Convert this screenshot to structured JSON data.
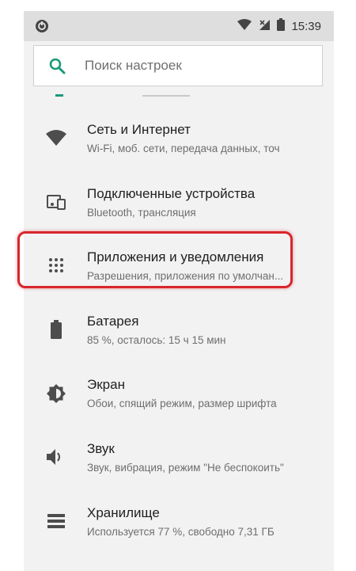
{
  "status_bar": {
    "time": "15:39",
    "icons": [
      "sync-icon",
      "wifi-icon",
      "no-signal-icon",
      "battery-icon"
    ]
  },
  "search": {
    "placeholder": "Поиск настроек"
  },
  "settings_items": [
    {
      "title": "Сеть и Интернет",
      "subtitle": "Wi-Fi, моб. сети, передача данных, точ",
      "icon": "wifi-icon"
    },
    {
      "title": "Подключенные устройства",
      "subtitle": "Bluetooth, трансляция",
      "icon": "devices-icon"
    },
    {
      "title": "Приложения и уведомления",
      "subtitle": "Разрешения, приложения по умолчан...",
      "icon": "apps-grid-icon"
    },
    {
      "title": "Батарея",
      "subtitle": "85 %, осталось: 15 ч 15 мин",
      "icon": "battery-icon"
    },
    {
      "title": "Экран",
      "subtitle": "Обои, спящий режим, размер шрифта",
      "icon": "brightness-icon"
    },
    {
      "title": "Звук",
      "subtitle": "Звук, вибрация, режим \"Не беспокоить\"",
      "icon": "volume-icon"
    },
    {
      "title": "Хранилище",
      "subtitle": "Используется 77 %, свободно 7,31 ГБ",
      "icon": "storage-icon"
    }
  ],
  "colors": {
    "accent": "#1a9a7a",
    "highlight": "#d8262c",
    "icon": "#4d4d4d",
    "background": "#f2f2f2"
  }
}
